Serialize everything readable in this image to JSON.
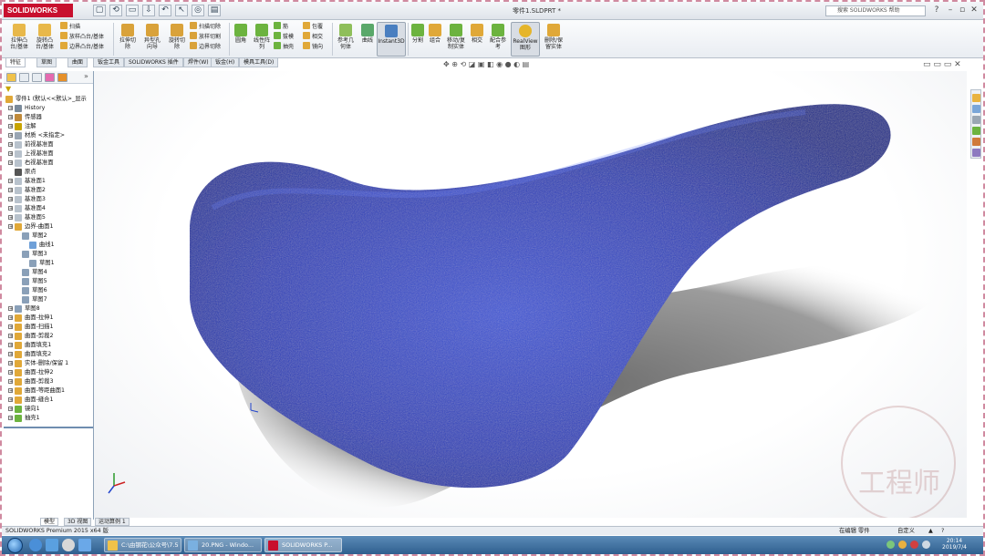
{
  "app": {
    "logo": "SOLIDWORKS",
    "title": "零件1.SLDPRT *",
    "search_placeholder": "搜索 SOLIDWORKS 帮助"
  },
  "quick_access": [
    "▢",
    "⟲",
    "▭",
    "⇩",
    "↶",
    "↖",
    "◎",
    "▤"
  ],
  "ribbon": {
    "big_tools": [
      {
        "id": "extrude-boss",
        "label": "拉伸凸\n台/基体"
      },
      {
        "id": "revolve-boss",
        "label": "旋转凸\n台/基体"
      },
      {
        "id": "extrude-cut",
        "label": "拉伸切\n除"
      },
      {
        "id": "hole-wizard",
        "label": "异型孔\n向导"
      },
      {
        "id": "revolve-cut",
        "label": "旋转切\n除"
      },
      {
        "id": "fillet",
        "label": "圆角"
      },
      {
        "id": "linear-pattern",
        "label": "线性阵\n列"
      },
      {
        "id": "ref-geometry",
        "label": "参考几\n何体"
      },
      {
        "id": "curves",
        "label": "曲线"
      },
      {
        "id": "instant3d",
        "label": "Instant3D"
      },
      {
        "id": "split",
        "label": "分割"
      },
      {
        "id": "combine",
        "label": "组合"
      },
      {
        "id": "move-copy",
        "label": "移动/复\n制实体"
      },
      {
        "id": "intersect",
        "label": "相交"
      },
      {
        "id": "mate-ref",
        "label": "配合参\n考"
      },
      {
        "id": "realview",
        "label": "RealView\n图形"
      },
      {
        "id": "delete-body",
        "label": "删除/保\n留实体"
      }
    ],
    "small_tools": [
      {
        "id": "sweep-boss",
        "label": "扫描"
      },
      {
        "id": "loft-boss",
        "label": "放样凸台/基体"
      },
      {
        "id": "boundary-boss",
        "label": "边界凸台/基体"
      },
      {
        "id": "sweep-cut",
        "label": "扫描切除"
      },
      {
        "id": "loft-cut",
        "label": "放样切割"
      },
      {
        "id": "boundary-cut",
        "label": "边界切除"
      },
      {
        "id": "rib",
        "label": "筋"
      },
      {
        "id": "draft",
        "label": "拔模"
      },
      {
        "id": "shell",
        "label": "抽壳"
      },
      {
        "id": "wrap",
        "label": "包覆"
      },
      {
        "id": "intersect2",
        "label": "相交"
      },
      {
        "id": "mirror",
        "label": "镜向"
      }
    ]
  },
  "tabs": [
    "特征",
    "草图",
    "曲面",
    "钣金工具",
    "SOLIDWORKS 插件",
    "焊件(W)",
    "钣金(H)",
    "模具工具(D)"
  ],
  "tree": {
    "root": "零件1 (默认<<默认>_显示",
    "items": [
      {
        "label": "History"
      },
      {
        "label": "传感器"
      },
      {
        "label": "注解"
      },
      {
        "label": "材质 <未指定>"
      },
      {
        "label": "前视基准面"
      },
      {
        "label": "上视基准面"
      },
      {
        "label": "右视基准面"
      },
      {
        "label": "原点"
      },
      {
        "label": "基准面1"
      },
      {
        "label": "基准面2"
      },
      {
        "label": "基准面3"
      },
      {
        "label": "基准面4"
      },
      {
        "label": "基准面5"
      },
      {
        "label": "边界-曲面1"
      },
      {
        "label": "草图2"
      },
      {
        "label": "曲线1"
      },
      {
        "label": "草图3"
      },
      {
        "label": "草图1"
      },
      {
        "label": "草图4"
      },
      {
        "label": "草图5"
      },
      {
        "label": "草图6"
      },
      {
        "label": "草图7"
      },
      {
        "label": "草图8"
      },
      {
        "label": "曲面-拉伸1"
      },
      {
        "label": "曲面-扫描1"
      },
      {
        "label": "曲面-剪裁2"
      },
      {
        "label": "曲面填充1"
      },
      {
        "label": "曲面填充2"
      },
      {
        "label": "实体-删除/保留 1"
      },
      {
        "label": "曲面-拉伸2"
      },
      {
        "label": "曲面-剪裁3"
      },
      {
        "label": "曲面-等距曲面1"
      },
      {
        "label": "曲面-缝合1"
      },
      {
        "label": "镜向1"
      },
      {
        "label": "抽壳1"
      }
    ]
  },
  "bottom_tabs": [
    "模型",
    "3D 视图",
    "运动算例 1"
  ],
  "status": {
    "left": "SOLIDWORKS Premium 2015 x64 版",
    "editing": "在编辑 零件",
    "custom": "自定义"
  },
  "taskbar": {
    "tasks": [
      "C:\\由钢花\\公众号\\7.5",
      "20.PNG - Windo...",
      "SOLIDWORKS P..."
    ],
    "time": "20:14",
    "date": "2019/7/4"
  },
  "watermark": "工程师",
  "colors": {
    "brand": "#c8102e",
    "saddle": "#2a3fb8",
    "taskbar": "#2f5f8e"
  }
}
